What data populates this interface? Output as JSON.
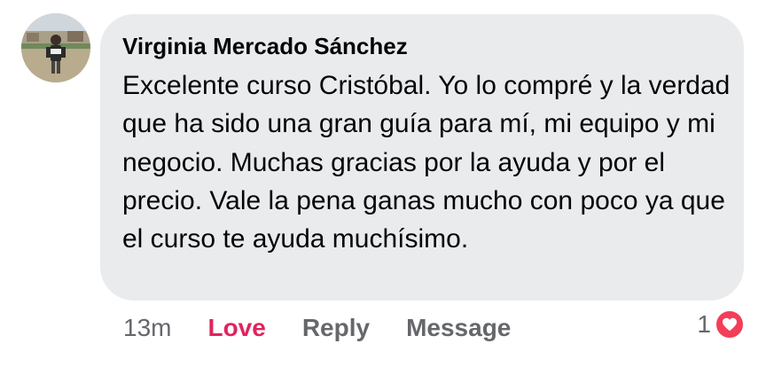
{
  "comment": {
    "author": "Virginia Mercado Sánchez",
    "text": "Excelente curso Cristóbal. Yo lo compré y la verdad que ha sido una gran guía para mí, mi equipo y mi negocio. Muchas gracias por la ayuda y por el precio. Vale la pena ganas mucho con poco ya que el curso te ayuda muchísimo."
  },
  "actions": {
    "time": "13m",
    "love": "Love",
    "reply": "Reply",
    "message": "Message"
  },
  "reactions": {
    "count": "1",
    "icon": "heart-icon",
    "color": "#f33e58"
  },
  "colors": {
    "bubble": "#eaebed",
    "text": "#050505",
    "muted": "#65676b",
    "love": "#e0245e"
  }
}
